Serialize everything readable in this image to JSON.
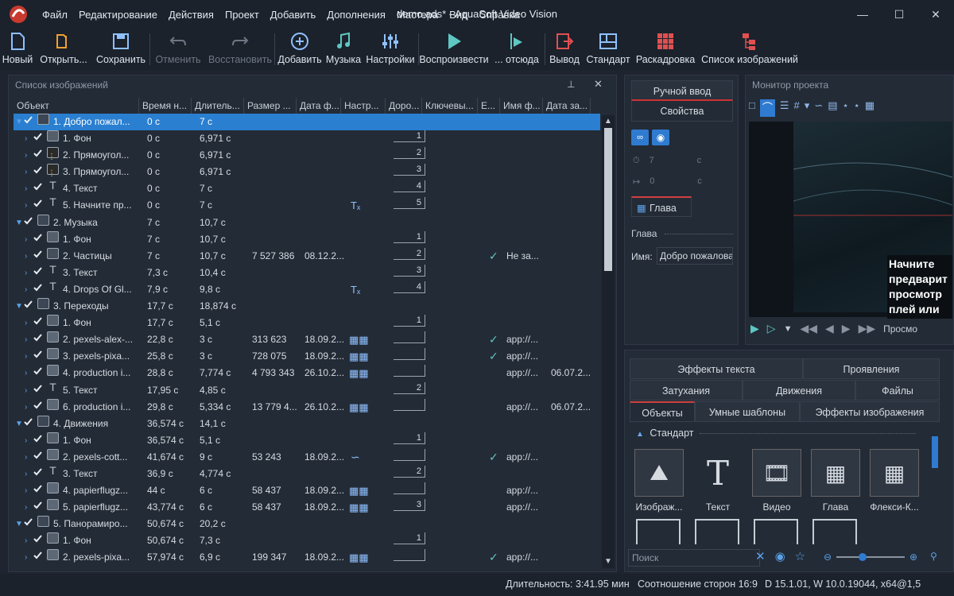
{
  "app": {
    "window_title": "demo.ads* - AquaSoft Video Vision"
  },
  "menu": [
    "Файл",
    "Редактирование",
    "Действия",
    "Проект",
    "Добавить",
    "Дополнения",
    "Мастера",
    "Вид",
    "Справка"
  ],
  "toolbar": [
    {
      "label": "Новый",
      "icon": "new-file-icon",
      "enabled": true
    },
    {
      "label": "Открыть...",
      "icon": "open-icon",
      "enabled": true
    },
    {
      "label": "Сохранить",
      "icon": "save-icon",
      "enabled": true
    },
    {
      "label": "Отменить",
      "icon": "undo-icon",
      "enabled": false
    },
    {
      "label": "Восстановить",
      "icon": "redo-icon",
      "enabled": false
    },
    {
      "label": "Добавить",
      "icon": "add-icon",
      "enabled": true
    },
    {
      "label": "Музыка",
      "icon": "music-icon",
      "enabled": true
    },
    {
      "label": "Настройки",
      "icon": "settings-icon",
      "enabled": true
    },
    {
      "label": "Воспроизвести",
      "icon": "play-icon",
      "enabled": true
    },
    {
      "label": "... отсюда",
      "icon": "play-from-here-icon",
      "enabled": true
    },
    {
      "label": "Вывод",
      "icon": "export-icon",
      "enabled": true
    },
    {
      "label": "Стандарт",
      "icon": "standard-layout-icon",
      "enabled": true
    },
    {
      "label": "Раскадровка",
      "icon": "storyboard-icon",
      "enabled": true
    },
    {
      "label": "Список изображений",
      "icon": "image-list-icon",
      "enabled": true
    }
  ],
  "image_list": {
    "title": "Список изображений",
    "columns": [
      "Объект",
      "Время н...",
      "Длитель...",
      "Размер ...",
      "Дата ф...",
      "Настр...",
      "Доро...",
      "Ключевы...",
      "E...",
      "Имя ф...",
      "Дата за..."
    ],
    "rows": [
      {
        "level": 0,
        "name": "1. Добро пожал...",
        "start": "0 с",
        "dur": "7 с",
        "selected": true,
        "icon": "chapter"
      },
      {
        "level": 1,
        "name": "1. Фон",
        "start": "0 с",
        "dur": "6,971 с",
        "track": "1",
        "icon": "bg"
      },
      {
        "level": 1,
        "name": "2. Прямоугол...",
        "start": "0 с",
        "dur": "6,971 с",
        "track": "2",
        "icon": "rect"
      },
      {
        "level": 1,
        "name": "3. Прямоугол...",
        "start": "0 с",
        "dur": "6,971 с",
        "track": "3",
        "icon": "rect"
      },
      {
        "level": 1,
        "name": "4. Текст",
        "start": "0 с",
        "dur": "7 с",
        "track": "4",
        "icon": "text"
      },
      {
        "level": 1,
        "name": "5. Начните пр...",
        "start": "0 с",
        "dur": "7 с",
        "track": "5",
        "icon": "text",
        "fx": "text-effect"
      },
      {
        "level": 0,
        "name": "2. Музыка",
        "start": "7 с",
        "dur": "10,7 с",
        "icon": "chapter"
      },
      {
        "level": 1,
        "name": "1. Фон",
        "start": "7 с",
        "dur": "10,7 с",
        "track": "1",
        "icon": "bg"
      },
      {
        "level": 1,
        "name": "2. Частицы",
        "start": "7 с",
        "dur": "10,7 с",
        "size": "7 527 386",
        "date": "08.12.2...",
        "track": "2",
        "icon": "particles",
        "check": true,
        "file": "Не за..."
      },
      {
        "level": 1,
        "name": "3. Текст",
        "start": "7,3 с",
        "dur": "10,4 с",
        "track": "3",
        "icon": "text"
      },
      {
        "level": 1,
        "name": "4. Drops Of Gl...",
        "start": "7,9 с",
        "dur": "9,8 с",
        "track": "4",
        "icon": "text",
        "fx": "text-effect"
      },
      {
        "level": 0,
        "name": "3. Переходы",
        "start": "17,7 с",
        "dur": "18,874 с",
        "icon": "chapter"
      },
      {
        "level": 1,
        "name": "1. Фон",
        "start": "17,7 с",
        "dur": "5,1 с",
        "track": "1",
        "icon": "bg"
      },
      {
        "level": 1,
        "name": "2. pexels-alex-...",
        "start": "22,8 с",
        "dur": "3 с",
        "size": "313 623",
        "date": "18.09.2...",
        "icon": "img",
        "fx": "img2",
        "check": true,
        "file": "app://..."
      },
      {
        "level": 1,
        "name": "3. pexels-pixa...",
        "start": "25,8 с",
        "dur": "3 с",
        "size": "728 075",
        "date": "18.09.2...",
        "icon": "img",
        "fx": "img2",
        "check": true,
        "file": "app://..."
      },
      {
        "level": 1,
        "name": "4. production i...",
        "start": "28,8 с",
        "dur": "7,774 с",
        "size": "4 793 343",
        "date": "26.10.2...",
        "icon": "img",
        "fx": "img2",
        "file": "app://...",
        "fdate": "06.07.2..."
      },
      {
        "level": 1,
        "name": "5. Текст",
        "start": "17,95 с",
        "dur": "4,85 с",
        "track": "2",
        "icon": "text"
      },
      {
        "level": 1,
        "name": "6. production i...",
        "start": "29,8 с",
        "dur": "5,334 с",
        "size": "13 779 4...",
        "date": "26.10.2...",
        "icon": "img",
        "fx": "img2",
        "file": "app://...",
        "fdate": "06.07.2..."
      },
      {
        "level": 0,
        "name": "4. Движения",
        "start": "36,574 с",
        "dur": "14,1 с",
        "icon": "chapter"
      },
      {
        "level": 1,
        "name": "1. Фон",
        "start": "36,574 с",
        "dur": "5,1 с",
        "track": "1",
        "icon": "bg"
      },
      {
        "level": 1,
        "name": "2. pexels-cott...",
        "start": "41,674 с",
        "dur": "9 с",
        "size": "53 243",
        "date": "18.09.2...",
        "icon": "img",
        "fx": "path",
        "check": true,
        "file": "app://..."
      },
      {
        "level": 1,
        "name": "3. Текст",
        "start": "36,9 с",
        "dur": "4,774 с",
        "track": "2",
        "icon": "text"
      },
      {
        "level": 1,
        "name": "4. papierflugz...",
        "start": "44 с",
        "dur": "6 с",
        "size": "58 437",
        "date": "18.09.2...",
        "icon": "img",
        "fx": "img2",
        "file": "app://..."
      },
      {
        "level": 1,
        "name": "5. papierflugz...",
        "start": "43,774 с",
        "dur": "6 с",
        "size": "58 437",
        "date": "18.09.2...",
        "track": "3",
        "icon": "img",
        "fx": "img2",
        "file": "app://..."
      },
      {
        "level": 0,
        "name": "5. Панорамиро...",
        "start": "50,674 с",
        "dur": "20,2 с",
        "icon": "chapter"
      },
      {
        "level": 1,
        "name": "1. Фон",
        "start": "50,674 с",
        "dur": "7,3 с",
        "track": "1",
        "icon": "bg"
      },
      {
        "level": 1,
        "name": "2. pexels-pixa...",
        "start": "57,974 с",
        "dur": "6,9 с",
        "size": "199 347",
        "date": "18.09.2...",
        "icon": "img",
        "fx": "img2",
        "check": true,
        "file": "app://..."
      }
    ]
  },
  "props": {
    "tab_manual": "Ручной ввод",
    "tab_props": "Свойства",
    "duration_val": "7",
    "duration_unit": "с",
    "pos_val": "0",
    "pos_unit": "с",
    "chapter_tab": "Глава",
    "section": "Глава",
    "name_label": "Имя:",
    "name_value": "Добро пожалова"
  },
  "monitor": {
    "title": "Монитор проекта",
    "overlay_text": [
      "Начните",
      "предварит",
      "просмотр",
      "плей или"
    ],
    "preview_btn": "Просмо"
  },
  "objects": {
    "tabs_row1": [
      "Эффекты текста",
      "Проявления"
    ],
    "tabs_row2": [
      "Затухания",
      "Движения",
      "Файлы"
    ],
    "tabs_row3": [
      "Объекты",
      "Умные шаблоны",
      "Эффекты изображения"
    ],
    "group": "Стандарт",
    "items": [
      "Изображ...",
      "Текст",
      "Видео",
      "Глава",
      "Флекси-К..."
    ],
    "search_placeholder": "Поиск"
  },
  "status": {
    "duration": "Длительность: 3:41.95 мин",
    "aspect": "Соотношение сторон 16:9",
    "version": "D 15.1.01, W 10.0.19044, x64@1,5"
  }
}
